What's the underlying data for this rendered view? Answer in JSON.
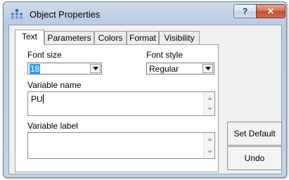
{
  "window": {
    "title": "Object Properties",
    "help_label": "?",
    "close_label": "✕"
  },
  "tabs": [
    {
      "label": "Text",
      "active": true
    },
    {
      "label": "Parameters",
      "active": false
    },
    {
      "label": "Colors",
      "active": false
    },
    {
      "label": "Format",
      "active": false
    },
    {
      "label": "Visibility",
      "active": false
    }
  ],
  "font_size": {
    "label": "Font size",
    "value": "18"
  },
  "font_style": {
    "label": "Font style",
    "value": "Regular"
  },
  "variable_name": {
    "label": "Variable name",
    "value": "PU"
  },
  "variable_label": {
    "label": "Variable label",
    "value": ""
  },
  "buttons": {
    "set_default": "Set Default",
    "undo": "Undo"
  },
  "icons": {
    "app": "object-properties-icon",
    "dropdown": "chevron-down-icon",
    "scroll_up": "scroll-up-icon",
    "scroll_down": "scroll-down-icon"
  }
}
